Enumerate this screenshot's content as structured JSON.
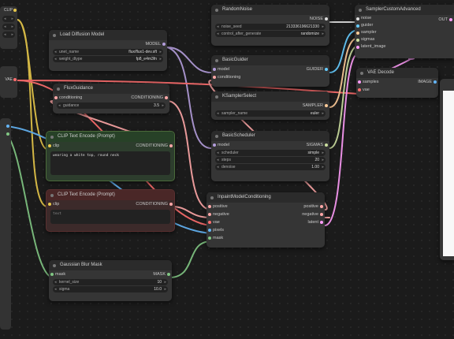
{
  "colors": {
    "clip": "#e8c84a",
    "model": "#b39ddb",
    "vae": "#ff6e6e",
    "conditioning": "#ffa7a7",
    "latent": "#ff9cf9",
    "mask": "#81c784",
    "image": "#64b5f6",
    "noise": "#dddddd",
    "guider": "#66ccff",
    "sampler": "#ffcc99",
    "sigmas": "#cde0a0"
  },
  "left_top": {
    "clip": "CLIP"
  },
  "left_mid": {
    "vae": "VAE"
  },
  "load_diffusion": {
    "title": "Load Diffusion Model",
    "out_model": "MODEL",
    "w1_label": "unet_name",
    "w1_value": "flux/flux1-dev.sft",
    "w2_label": "weight_dtype",
    "w2_value": "fp8_e4m3fn"
  },
  "flux_guidance": {
    "title": "FluxGuidance",
    "in_cond": "conditioning",
    "out_cond": "CONDITIONING",
    "w1_label": "guidance",
    "w1_value": "3.5"
  },
  "clip_pos": {
    "title": "CLIP Text Encode (Prompt)",
    "in_clip": "clip",
    "out_cond": "CONDITIONING",
    "text": "wearing a white top, round neck"
  },
  "clip_neg": {
    "title": "CLIP Text Encode (Prompt)",
    "in_clip": "clip",
    "out_cond": "CONDITIONING",
    "text": "text"
  },
  "gaussian": {
    "title": "Gaussian Blur Mask",
    "in_mask": "mask",
    "out_mask": "MASK",
    "w1_label": "kernel_size",
    "w1_value": "10",
    "w2_label": "sigma",
    "w2_value": "10.0"
  },
  "random_noise": {
    "title": "RandomNoise",
    "out_noise": "NOISE",
    "w1_label": "noise_seed",
    "w1_value": "213336196621330",
    "w2_label": "control_after_generate",
    "w2_value": "randomize"
  },
  "basic_guider": {
    "title": "BasicGuider",
    "in_model": "model",
    "in_cond": "conditioning",
    "out_guider": "GUIDER"
  },
  "ksampler_select": {
    "title": "KSamplerSelect",
    "out_sampler": "SAMPLER",
    "w1_label": "sampler_name",
    "w1_value": "euler"
  },
  "basic_scheduler": {
    "title": "BasicScheduler",
    "in_model": "model",
    "out_sigmas": "SIGMAS",
    "w1_label": "scheduler",
    "w1_value": "simple",
    "w2_label": "steps",
    "w2_value": "20",
    "w3_label": "denoise",
    "w3_value": "1.00"
  },
  "inpaint": {
    "title": "InpaintModelConditioning",
    "in1": "positive",
    "in2": "negative",
    "in3": "vae",
    "in4": "pixels",
    "in5": "mask",
    "out1": "positive",
    "out2": "negative",
    "out3": "latent"
  },
  "sampler_adv": {
    "title": "SamplerCustomAdvanced",
    "in1": "noise",
    "in2": "guider",
    "in3": "sampler",
    "in4": "sigmas",
    "in5": "latent_image",
    "out1": "OUT"
  },
  "vae_decode": {
    "title": "VAE Decode",
    "in1": "samples",
    "in2": "vae",
    "out1": "IMAGE"
  }
}
